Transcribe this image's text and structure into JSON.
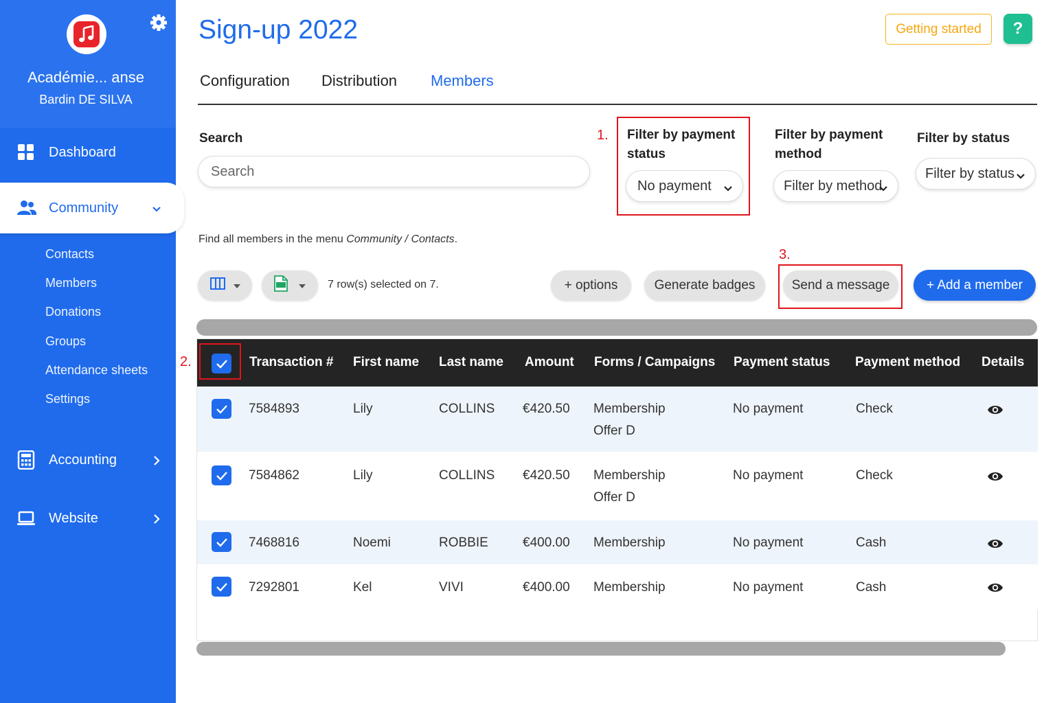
{
  "sidebar": {
    "org_name": "Académie... anse",
    "user_name": "Bardin DE SILVA",
    "nav": {
      "dashboard": "Dashboard",
      "community": "Community",
      "accounting": "Accounting",
      "website": "Website"
    },
    "community_sub": [
      "Contacts",
      "Members",
      "Donations",
      "Groups",
      "Attendance sheets",
      "Settings"
    ]
  },
  "header": {
    "title": "Sign-up 2022",
    "getting_started": "Getting started",
    "help": "?"
  },
  "tabs": [
    "Configuration",
    "Distribution",
    "Members"
  ],
  "active_tab": "Members",
  "filters": {
    "search_label": "Search",
    "search_placeholder": "Search",
    "payment_status_label": "Filter by payment status",
    "payment_status_value": "No payment",
    "payment_method_label": "Filter by payment method",
    "payment_method_value": "Filter by method",
    "status_label": "Filter by status",
    "status_value": "Filter by status"
  },
  "hint": {
    "prefix": "Find all members in the menu ",
    "path": "Community / Contacts",
    "suffix": "."
  },
  "toolbar": {
    "selection": "7 row(s) selected on 7.",
    "options": "+ options",
    "generate_badges": "Generate badges",
    "send_message": "Send a message",
    "add_member": "+ Add a member"
  },
  "annotations": [
    "1.",
    "2.",
    "3."
  ],
  "table": {
    "columns": [
      "Transaction #",
      "First name",
      "Last name",
      "Amount",
      "Forms / Campaigns",
      "Payment status",
      "Payment method",
      "Details"
    ],
    "rows": [
      {
        "transaction": "7584893",
        "first": "Lily",
        "last": "COLLINS",
        "amount": "€420.50",
        "form": "Membership",
        "form2": "Offer D",
        "status": "No payment",
        "method": "Check"
      },
      {
        "transaction": "7584862",
        "first": "Lily",
        "last": "COLLINS",
        "amount": "€420.50",
        "form": "Membership",
        "form2": "Offer D",
        "status": "No payment",
        "method": "Check"
      },
      {
        "transaction": "7468816",
        "first": "Noemi",
        "last": "ROBBIE",
        "amount": "€400.00",
        "form": "Membership",
        "form2": "",
        "status": "No payment",
        "method": "Cash"
      },
      {
        "transaction": "7292801",
        "first": "Kel",
        "last": "VIVI",
        "amount": "€400.00",
        "form": "Membership",
        "form2": "",
        "status": "No payment",
        "method": "Cash"
      }
    ]
  },
  "colors": {
    "primary": "#1f6bec",
    "sidebar": "#1f6bec",
    "accent_orange": "#f5a70f",
    "help_green": "#1fbf92",
    "highlight_red": "#e0151b",
    "table_header": "#242424"
  }
}
